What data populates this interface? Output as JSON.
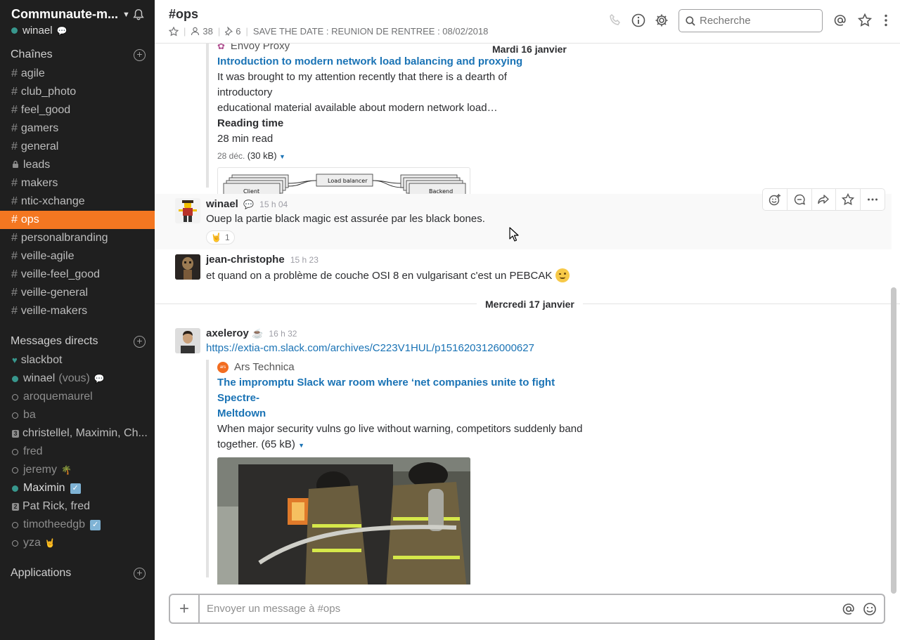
{
  "workspace": {
    "name": "Communaute-m...",
    "user": "winael"
  },
  "sidebar": {
    "channels_title": "Chaînes",
    "channels": [
      {
        "name": "agile",
        "locked": false,
        "active": false
      },
      {
        "name": "club_photo",
        "locked": false,
        "active": false
      },
      {
        "name": "feel_good",
        "locked": false,
        "active": false
      },
      {
        "name": "gamers",
        "locked": false,
        "active": false
      },
      {
        "name": "general",
        "locked": false,
        "active": false
      },
      {
        "name": "leads",
        "locked": true,
        "active": false
      },
      {
        "name": "makers",
        "locked": false,
        "active": false
      },
      {
        "name": "ntic-xchange",
        "locked": false,
        "active": false
      },
      {
        "name": "ops",
        "locked": false,
        "active": true
      },
      {
        "name": "personalbranding",
        "locked": false,
        "active": false
      },
      {
        "name": "veille-agile",
        "locked": false,
        "active": false
      },
      {
        "name": "veille-feel_good",
        "locked": false,
        "active": false
      },
      {
        "name": "veille-general",
        "locked": false,
        "active": false
      },
      {
        "name": "veille-makers",
        "locked": false,
        "active": false
      }
    ],
    "dm_title": "Messages directs",
    "dms": {
      "slackbot": "slackbot",
      "winael": "winael",
      "winael_vous": "(vous)",
      "aroquemaurel": "aroquemaurel",
      "ba": "ba",
      "group3": "christellel, Maximin, Ch...",
      "group3_count": "3",
      "fred": "fred",
      "jeremy": "jeremy",
      "maximin": "Maximin",
      "group2": "Pat Rick, fred",
      "group2_count": "2",
      "timotheedgb": "timotheedgb",
      "yza": "yza"
    },
    "apps_title": "Applications"
  },
  "header": {
    "channel": "#ops",
    "members": "38",
    "pinned": "6",
    "topic": "SAVE THE DATE : REUNION DE RENTREE : 08/02/2018",
    "search_placeholder": "Recherche"
  },
  "messages": {
    "day1": "Mardi 16 janvier",
    "envoy": {
      "service": "Envoy Proxy",
      "title": "Introduction to modern network load balancing and proxying",
      "text1": "It was brought to my attention recently that there is a dearth of introductory",
      "text2": "educational material available about modern network load…",
      "field_title": "Reading time",
      "field_value": "28 min read",
      "date": "28 déc.",
      "size": "(30 kB)",
      "img_client": "Client",
      "img_lb": "Load balancer",
      "img_backend": "Backend"
    },
    "m1": {
      "author": "winael",
      "time": "15 h 04",
      "text": "Ouep la partie black magic est assurée par les black bones.",
      "reaction_count": "1"
    },
    "m2": {
      "author": "jean-christophe",
      "time": "15 h 23",
      "text": "et quand on a problème de couche OSI 8 en vulgarisant c'est un PEBCAK"
    },
    "day2": "Mercredi 17 janvier",
    "m3": {
      "author": "axeleroy",
      "time": "16 h 32",
      "link": "https://extia-cm.slack.com/archives/C223V1HUL/p1516203126000627",
      "service": "Ars Technica",
      "title1": "The impromptu Slack war room where ‘net companies unite to fight Spectre-",
      "title2": "Meltdown",
      "text1": "When major security vulns go live without warning, competitors suddenly band",
      "text2": "together. (65 kB)"
    }
  },
  "composer": {
    "placeholder": "Envoyer un message à #ops"
  }
}
